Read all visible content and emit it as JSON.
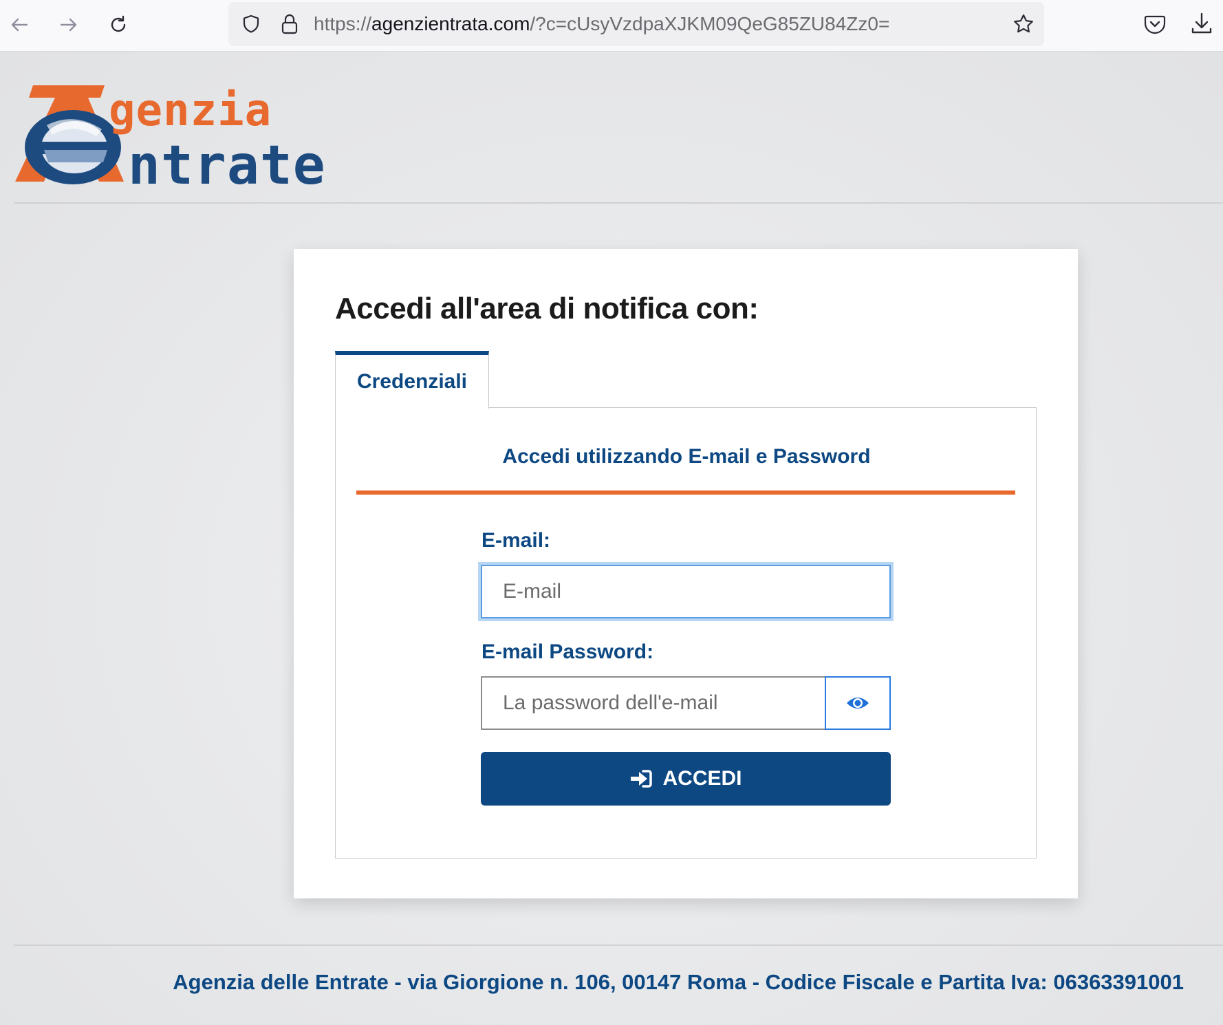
{
  "browser": {
    "url_scheme": "https://",
    "url_host": "agenzientrata.com",
    "url_rest": "/?c=cUsyVzdpaXJKM09QeG85ZU84Zz0=",
    "icons": [
      "back-arrow-icon",
      "forward-arrow-icon",
      "reload-icon",
      "shield-icon",
      "lock-icon",
      "star-icon",
      "pocket-icon",
      "download-icon"
    ]
  },
  "logo": {
    "line1": "genzia",
    "line2": "ntrate"
  },
  "login": {
    "title": "Accedi all'area di notifica con:",
    "tab_label": "Credenziali",
    "subtitle": "Accedi utilizzando E-mail e Password",
    "email_label": "E-mail:",
    "email_placeholder": "E-mail",
    "email_value": "",
    "password_label": "E-mail Password:",
    "password_placeholder": "La password dell'e-mail",
    "password_value": "",
    "submit_label": "ACCEDI"
  },
  "footer": {
    "text": "Agenzia delle Entrate - via Giorgione n. 106, 00147 Roma - Codice Fiscale e Partita Iva: 06363391001"
  },
  "colors": {
    "brand_blue": "#0d4883",
    "brand_orange": "#e8692e",
    "focus_blue": "#5a9ce0"
  }
}
